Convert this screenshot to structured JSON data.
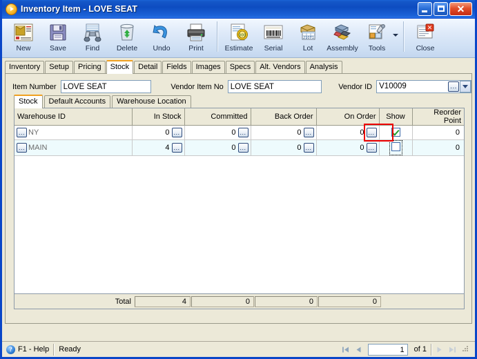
{
  "window": {
    "title_prefix": "Inventory Item",
    "title_sep": " - ",
    "title_item": "LOVE SEAT",
    "title_full": "Inventory Item - LOVE SEAT",
    "accent_blue": "#0a46c8",
    "tab_accent": "#f0a020",
    "highlight_red": "#ee0000",
    "controls": {
      "minimize": "Minimize",
      "maximize": "Maximize",
      "close": "Close"
    }
  },
  "toolbar": {
    "buttons": [
      {
        "label": "New",
        "icon": "new-document-icon"
      },
      {
        "label": "Save",
        "icon": "floppy-disk-icon"
      },
      {
        "label": "Find",
        "icon": "binoculars-icon"
      },
      {
        "label": "Delete",
        "icon": "recycle-bin-icon"
      },
      {
        "label": "Undo",
        "icon": "undo-arrow-icon"
      },
      {
        "label": "Print",
        "icon": "printer-icon"
      },
      {
        "label": "Estimate",
        "icon": "estimate-tag-icon"
      },
      {
        "label": "Serial",
        "icon": "barcode-icon"
      },
      {
        "label": "Lot",
        "icon": "lot-box-icon"
      },
      {
        "label": "Assembly",
        "icon": "assembly-icon"
      },
      {
        "label": "Tools",
        "icon": "tools-icon"
      },
      {
        "label": "Close",
        "icon": "close-window-icon"
      }
    ]
  },
  "main_tabs": [
    {
      "label": "Inventory",
      "active": false
    },
    {
      "label": "Setup",
      "active": false
    },
    {
      "label": "Pricing",
      "active": false
    },
    {
      "label": "Stock",
      "active": true
    },
    {
      "label": "Detail",
      "active": false
    },
    {
      "label": "Fields",
      "active": false
    },
    {
      "label": "Images",
      "active": false
    },
    {
      "label": "Specs",
      "active": false
    },
    {
      "label": "Alt. Vendors",
      "active": false
    },
    {
      "label": "Analysis",
      "active": false
    }
  ],
  "header_fields": {
    "item_number_label": "Item Number",
    "item_number_value": "LOVE SEAT",
    "vendor_item_no_label": "Vendor Item No",
    "vendor_item_no_value": "LOVE SEAT",
    "vendor_id_label": "Vendor ID",
    "vendor_id_value": "V10009",
    "ellipsis_label": "...",
    "dropdown_label": "Open vendor list"
  },
  "sub_tabs": [
    {
      "label": "Stock",
      "active": true
    },
    {
      "label": "Default Accounts",
      "active": false
    },
    {
      "label": "Warehouse Location",
      "active": false
    }
  ],
  "grid": {
    "columns": [
      {
        "label": "Warehouse ID",
        "align": "l"
      },
      {
        "label": "In Stock",
        "align": "r"
      },
      {
        "label": "Committed",
        "align": "r"
      },
      {
        "label": "Back Order",
        "align": "r"
      },
      {
        "label": "On Order",
        "align": "r"
      },
      {
        "label": "Show",
        "align": "c"
      },
      {
        "label": "Reorder Point",
        "align": "r"
      }
    ],
    "rows": [
      {
        "warehouse_id": "NY",
        "in_stock": "0",
        "committed": "0",
        "back_order": "0",
        "on_order": "0",
        "show": true,
        "reorder_point": "0",
        "focused": false,
        "highlighted": false
      },
      {
        "warehouse_id": "MAIN",
        "in_stock": "4",
        "committed": "0",
        "back_order": "0",
        "on_order": "0",
        "show": false,
        "reorder_point": "0",
        "focused": true,
        "highlighted": true
      }
    ],
    "cell_button_label": "..."
  },
  "totals": {
    "label": "Total",
    "in_stock": "4",
    "committed": "0",
    "back_order": "0",
    "on_order": "0"
  },
  "status_bar": {
    "help_text": "F1 - Help",
    "help_icon": "question-mark-icon",
    "status_text": "Ready",
    "first_label": "First record",
    "prev_label": "Previous record",
    "next_label": "Next record",
    "last_label": "Last record",
    "page_value": "1",
    "of_text": "of",
    "page_count": "1"
  }
}
